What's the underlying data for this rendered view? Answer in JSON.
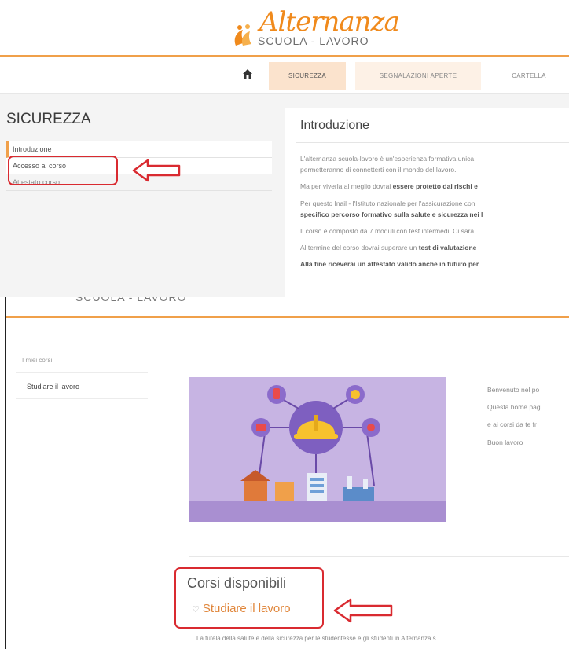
{
  "brand": {
    "script": "Alternanza",
    "sub": "SCUOLA - LAVORO"
  },
  "nav": {
    "tabs": [
      "SICUREZZA",
      "SEGNALAZIONI APERTE",
      "CARTELLA"
    ]
  },
  "sidebar": {
    "title": "SICUREZZA",
    "items": [
      "Introduzione",
      "Accesso al corso",
      "Attestato corso"
    ]
  },
  "intro": {
    "title": "Introduzione",
    "lines": [
      [
        "L'alternanza scuola-lavoro è un'esperienza formativa unica",
        ""
      ],
      [
        "permetteranno di connetterti con il mondo del lavoro.",
        ""
      ],
      [
        "Ma per viverla al meglio dovrai ",
        "essere protetto dai rischi e"
      ],
      [
        "Per questo Inail - l'Istituto nazionale per l'assicurazione con",
        ""
      ],
      [
        "",
        "specifico percorso formativo sulla salute e sicurezza nei l"
      ],
      [
        "Il corso è composto da 7 moduli con test intermedi. Ci sarà",
        ""
      ],
      [
        "Al termine del corso dovrai superare un ",
        "test di valutazione"
      ],
      [
        "",
        "Alla fine riceverai un attestato valido anche in futuro per"
      ]
    ]
  },
  "dashboard": {
    "mycourses_label": "I miei corsi",
    "mycourses_item": "Studiare il lavoro",
    "welcome_lines": [
      "Benvenuto nel po",
      "Questa home pag",
      "e ai corsi da te fr",
      "Buon lavoro"
    ],
    "corsi_title": "Corsi disponibili",
    "course_link": "Studiare il lavoro",
    "course_desc": "La tutela della salute e della sicurezza per le studentesse e gli studenti in Alternanza s"
  },
  "colors": {
    "brand_orange": "#f08a1c",
    "annotation_red": "#d92a30",
    "illustration_bg": "#c7b4e3"
  },
  "icons": [
    "home-icon",
    "course-icon",
    "arrow-left-icon"
  ]
}
